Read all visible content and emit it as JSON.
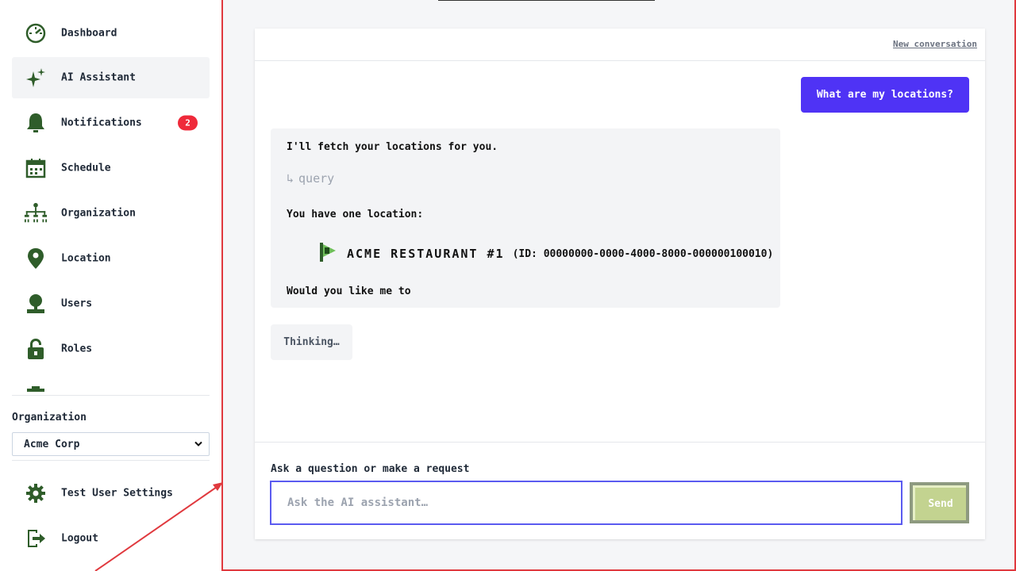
{
  "sidebar": {
    "items": [
      {
        "label": "Dashboard",
        "icon": "dashboard-icon"
      },
      {
        "label": "AI Assistant",
        "icon": "sparkle-icon",
        "active": true
      },
      {
        "label": "Notifications",
        "icon": "bell-icon",
        "badge": "2"
      },
      {
        "label": "Schedule",
        "icon": "calendar-icon"
      },
      {
        "label": "Organization",
        "icon": "org-chart-icon"
      },
      {
        "label": "Location",
        "icon": "map-pin-icon"
      },
      {
        "label": "Users",
        "icon": "user-icon"
      },
      {
        "label": "Roles",
        "icon": "lock-icon"
      }
    ],
    "organization": {
      "label": "Organization",
      "selected": "Acme Corp"
    },
    "footer_items": [
      {
        "label": "Test User Settings",
        "icon": "gear-icon"
      },
      {
        "label": "Logout",
        "icon": "logout-icon"
      }
    ]
  },
  "chat": {
    "new_conversation": "New conversation",
    "user_message": "What are my locations?",
    "assistant": {
      "line1": "I'll fetch your locations for you.",
      "tool_arrow": "↳",
      "tool_call": "query",
      "line2": "You have one location:",
      "location_name": "Acme Restaurant #1",
      "location_id": "(ID: 00000000-0000-4000-8000-000000100010)",
      "line3": "Would you like me to"
    },
    "thinking": "Thinking…",
    "composer": {
      "label": "Ask a question or make a request",
      "placeholder": "Ask the AI assistant…",
      "send_label": "Send"
    }
  },
  "colors": {
    "accent": "#4f33f5",
    "icon_green": "#2f5d2a",
    "badge_red": "#ef2a3a",
    "annotation_red": "#e0393e",
    "send_button": "#c3d390"
  }
}
